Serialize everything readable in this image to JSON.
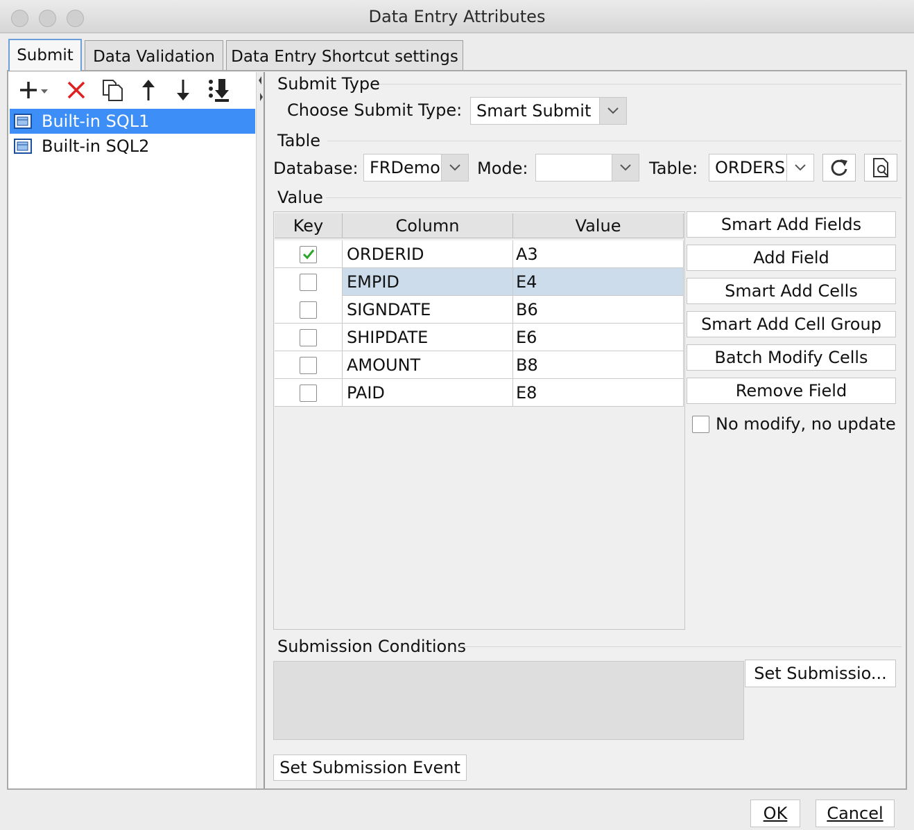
{
  "window": {
    "title": "Data Entry Attributes"
  },
  "tabs": [
    {
      "label": "Submit"
    },
    {
      "label": "Data Validation"
    },
    {
      "label": "Data Entry Shortcut settings"
    }
  ],
  "toolbar": {
    "icons": [
      "add-dropdown-icon",
      "delete-icon",
      "copy-icon",
      "move-up-icon",
      "move-down-icon",
      "move-bottom-icon"
    ],
    "colors": {
      "delete": "#e02020",
      "icon": "#222222"
    }
  },
  "sql_list": {
    "items": [
      {
        "label": "Built-in SQL1",
        "selected": true
      },
      {
        "label": "Built-in SQL2",
        "selected": false
      }
    ],
    "selection_color": "#3e8ef7"
  },
  "submit_type": {
    "section_title": "Submit Type",
    "label": "Choose Submit Type:",
    "value": "Smart Submit"
  },
  "table_section": {
    "section_title": "Table",
    "database_label": "Database:",
    "database_value": "FRDemo",
    "mode_label": "Mode:",
    "mode_value": "",
    "table_label": "Table:",
    "table_value": "ORDERS"
  },
  "value_section": {
    "section_title": "Value",
    "headers": {
      "key": "Key",
      "column": "Column",
      "value": "Value"
    },
    "rows": [
      {
        "key": true,
        "column": "ORDERID",
        "value": "A3"
      },
      {
        "key": false,
        "column": "EMPID",
        "value": "E4",
        "highlighted": true
      },
      {
        "key": false,
        "column": "SIGNDATE",
        "value": "B6"
      },
      {
        "key": false,
        "column": "SHIPDATE",
        "value": "E6"
      },
      {
        "key": false,
        "column": "AMOUNT",
        "value": "B8"
      },
      {
        "key": false,
        "column": "PAID",
        "value": "E8"
      }
    ],
    "highlight_color": "#ccdcea",
    "check_color": "#2aa52a"
  },
  "side_buttons": {
    "smart_add_fields": "Smart Add Fields",
    "add_field": "Add Field",
    "smart_add_cells": "Smart Add Cells",
    "smart_add_cell_group": "Smart Add Cell Group",
    "batch_modify_cells": "Batch Modify Cells",
    "remove_field": "Remove Field",
    "no_modify_label": "No modify, no update",
    "no_modify_checked": false
  },
  "conditions": {
    "section_title": "Submission Conditions",
    "set_button": "Set Submissio..."
  },
  "event": {
    "button": "Set Submission Event"
  },
  "footer": {
    "ok": "OK",
    "cancel": "Cancel"
  }
}
